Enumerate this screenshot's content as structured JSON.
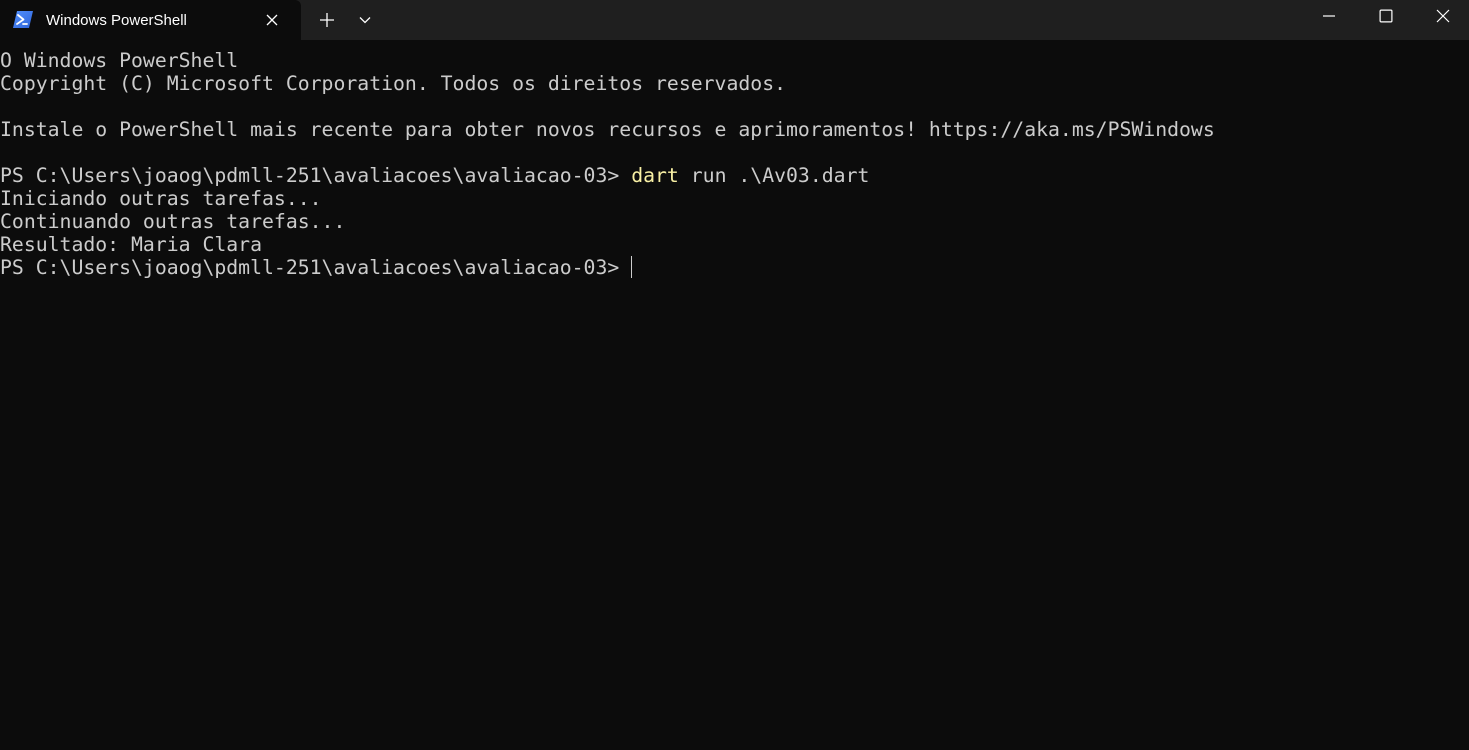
{
  "window": {
    "tab_title": "Windows PowerShell",
    "tab_icon": "powershell-icon",
    "colors": {
      "titlebar": "#1f1f1f",
      "terminal_bg": "#0c0c0c",
      "text": "#cccccc",
      "command": "#f9f1a5"
    }
  },
  "terminal": {
    "banner_1": "O Windows PowerShell",
    "banner_2": "Copyright (C) Microsoft Corporation. Todos os direitos reservados.",
    "banner_3": "Instale o PowerShell mais recente para obter novos recursos e aprimoramentos! https://aka.ms/PSWindows",
    "prompt": "PS C:\\Users\\joaog\\pdmll-251\\avaliacoes\\avaliacao-03> ",
    "command_name": "dart",
    "command_args": " run .\\Av03.dart",
    "output_1": "Iniciando outras tarefas...",
    "output_2": "Continuando outras tarefas...",
    "output_3": "Resultado: Maria Clara"
  }
}
